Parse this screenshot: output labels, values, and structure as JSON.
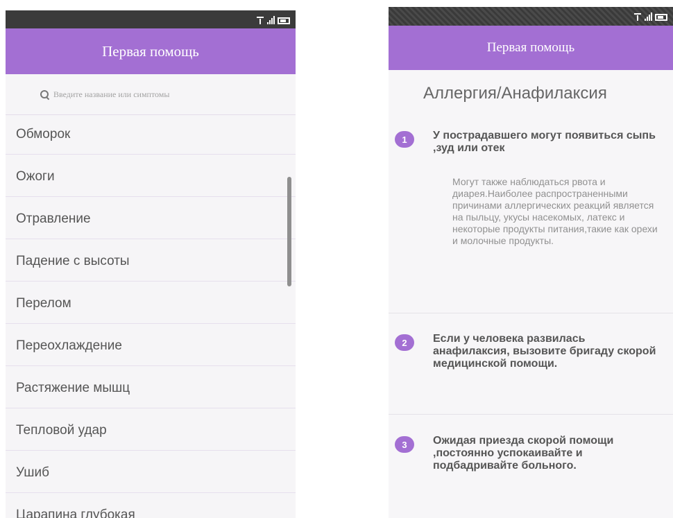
{
  "left": {
    "app_title": "Первая помощь",
    "search": {
      "placeholder": "Введите название или симптомы"
    },
    "items": [
      {
        "label": "Обморок"
      },
      {
        "label": "Ожоги"
      },
      {
        "label": "Отравление"
      },
      {
        "label": "Падение с высоты"
      },
      {
        "label": "Перелом"
      },
      {
        "label": "Переохлаждение"
      },
      {
        "label": "Растяжение мышц"
      },
      {
        "label": "Тепловой удар"
      },
      {
        "label": "Ушиб"
      },
      {
        "label": "Царапина глубокая"
      }
    ]
  },
  "right": {
    "app_title": "Первая помощь",
    "article_title": "Аллергия/Анафилаксия",
    "steps": [
      {
        "number": "1",
        "title": "У пострадавшего могут появиться сыпь ,зуд или отек",
        "detail": "Могут также наблюдаться рвота и диарея.Наиболее распространенными причинами аллергических реакций является на пыльцу, укусы насекомых, латекс и некоторые продукты питания,такие как орехи и молочные продукты."
      },
      {
        "number": "2",
        "title": "Если у человека развилась анафилаксия, вызовите бригаду скорой медицинской помощи."
      },
      {
        "number": "3",
        "title": "Ожидая приезда скорой помощи ,постоянно успокаивайте и подбадривайте больного."
      }
    ]
  },
  "icons": {
    "search": "search-icon",
    "wifi": "wifi-icon",
    "signal": "signal-icon",
    "battery": "battery-icon"
  },
  "colors": {
    "accent": "#a36fd3",
    "status_bar": "#3b3b3b",
    "text_primary": "#555555",
    "text_secondary": "#909090"
  }
}
